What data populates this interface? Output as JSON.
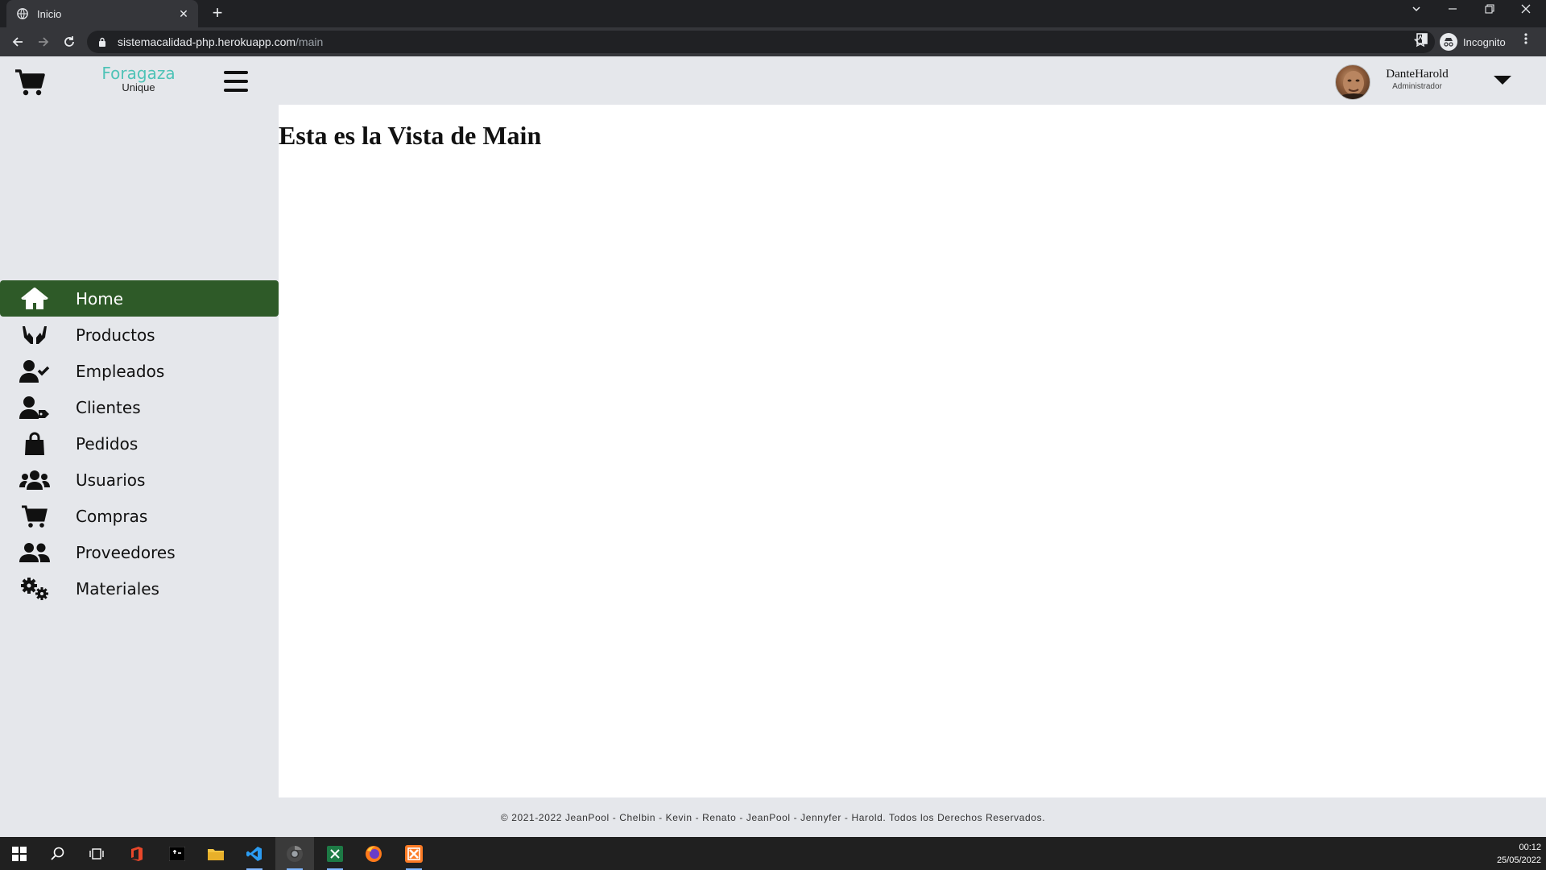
{
  "browser": {
    "tab_title": "Inicio",
    "url_host": "sistemacalidad-php.herokuapp.com",
    "url_path": "/main",
    "incognito_label": "Incognito"
  },
  "header": {
    "brand_name": "Foragaza",
    "brand_sub": "Unique",
    "user_name": "DanteHarold",
    "user_role": "Administrador"
  },
  "sidebar": {
    "items": [
      {
        "label": "Home",
        "icon": "home-icon",
        "active": true
      },
      {
        "label": "Productos",
        "icon": "hands-holding-icon"
      },
      {
        "label": "Empleados",
        "icon": "user-check-icon"
      },
      {
        "label": "Clientes",
        "icon": "user-tag-icon"
      },
      {
        "label": "Pedidos",
        "icon": "shopping-bag-icon"
      },
      {
        "label": "Usuarios",
        "icon": "users-icon"
      },
      {
        "label": "Compras",
        "icon": "cart-icon"
      },
      {
        "label": "Proveedores",
        "icon": "user-friends-icon"
      },
      {
        "label": "Materiales",
        "icon": "cogs-icon"
      }
    ]
  },
  "main": {
    "heading": "Esta es la Vista de Main"
  },
  "footer": {
    "text": "© 2021-2022 JeanPool - Chelbin - Kevin - Renato - JeanPool - Jennyfer - Harold. Todos los Derechos Reservados."
  },
  "taskbar": {
    "time": "00:12",
    "date": "25/05/2022"
  },
  "colors": {
    "brand_accent": "#4fc3b7",
    "active_nav": "#2e5a28",
    "page_bg": "#e5e7eb"
  }
}
